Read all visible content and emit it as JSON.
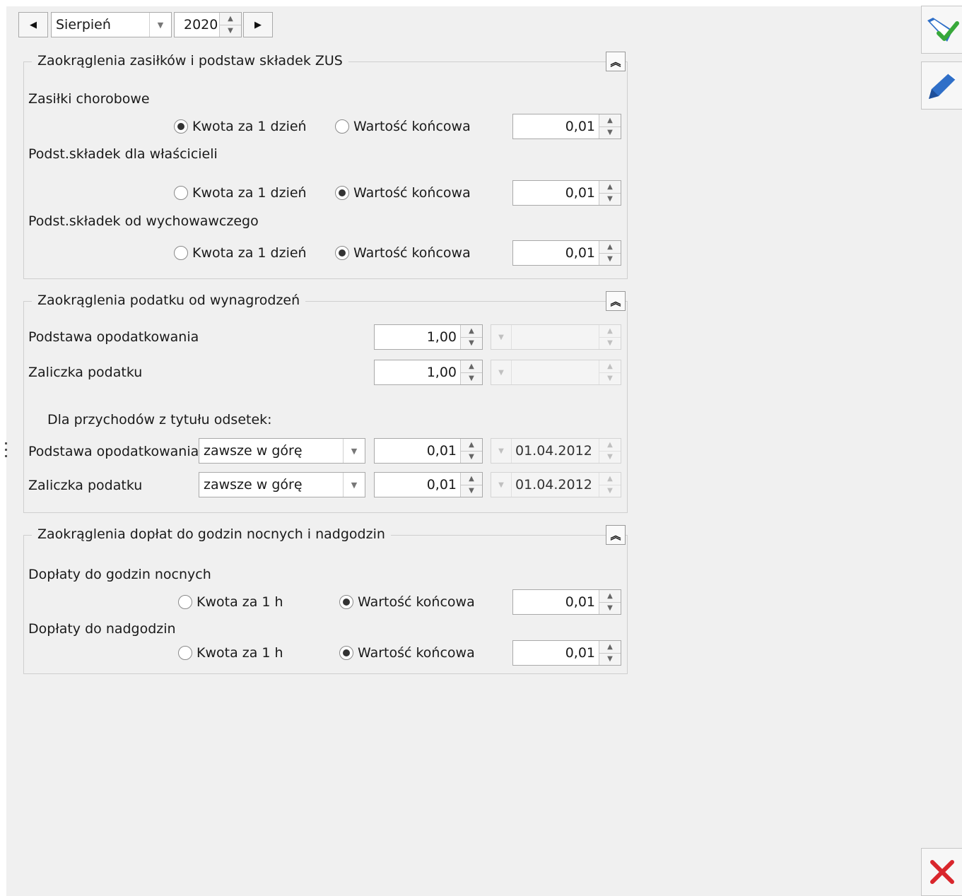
{
  "nav": {
    "prev_icon": "triangle-left-icon",
    "next_icon": "triangle-right-icon",
    "month": "Sierpień",
    "year": "2020"
  },
  "group_zus": {
    "title": "Zaokrąglenia zasiłków i podstaw składek ZUS",
    "rows": [
      {
        "label": "Zasiłki chorobowe",
        "opt1": "Kwota za 1 dzień",
        "opt2": "Wartość końcowa",
        "selected": "opt1",
        "value": "0,01"
      },
      {
        "label": "Podst.składek dla właścicieli",
        "opt1": "Kwota za 1 dzień",
        "opt2": "Wartość końcowa",
        "selected": "opt2",
        "value": "0,01"
      },
      {
        "label": "Podst.składek od wychowawczego",
        "opt1": "Kwota za 1 dzień",
        "opt2": "Wartość końcowa",
        "selected": "opt2",
        "value": "0,01"
      }
    ]
  },
  "group_tax": {
    "title": "Zaokrąglenia podatku od wynagrodzeń",
    "rows": [
      {
        "label": "Podstawa opodatkowania",
        "value": "1,00",
        "date": ""
      },
      {
        "label": "Zaliczka podatku",
        "value": "1,00",
        "date": ""
      }
    ],
    "interest_heading": "Dla przychodów z tytułu odsetek:",
    "interest_rows": [
      {
        "label": "Podstawa opodatkowania",
        "mode": "zawsze w górę",
        "value": "0,01",
        "date": "01.04.2012"
      },
      {
        "label": "Zaliczka podatku",
        "mode": "zawsze w górę",
        "value": "0,01",
        "date": "01.04.2012"
      }
    ]
  },
  "group_night": {
    "title": "Zaokrąglenia dopłat do godzin nocnych i nadgodzin",
    "rows": [
      {
        "label": "Dopłaty do godzin nocnych",
        "opt1": "Kwota za 1 h",
        "opt2": "Wartość końcowa",
        "selected": "opt2",
        "value": "0,01"
      },
      {
        "label": "Dopłaty do nadgodzin",
        "opt1": "Kwota za 1 h",
        "opt2": "Wartość końcowa",
        "selected": "opt2",
        "value": "0,01"
      }
    ]
  },
  "sidebar": {
    "save_icon": "save-check-icon",
    "edit_icon": "edit-pen-icon",
    "close_icon": "close-x-icon"
  },
  "colors": {
    "panel_bg": "#f0f0f0",
    "close_red": "#d9262c",
    "icon_blue": "#2f6fc8",
    "check_green": "#38a83a"
  }
}
